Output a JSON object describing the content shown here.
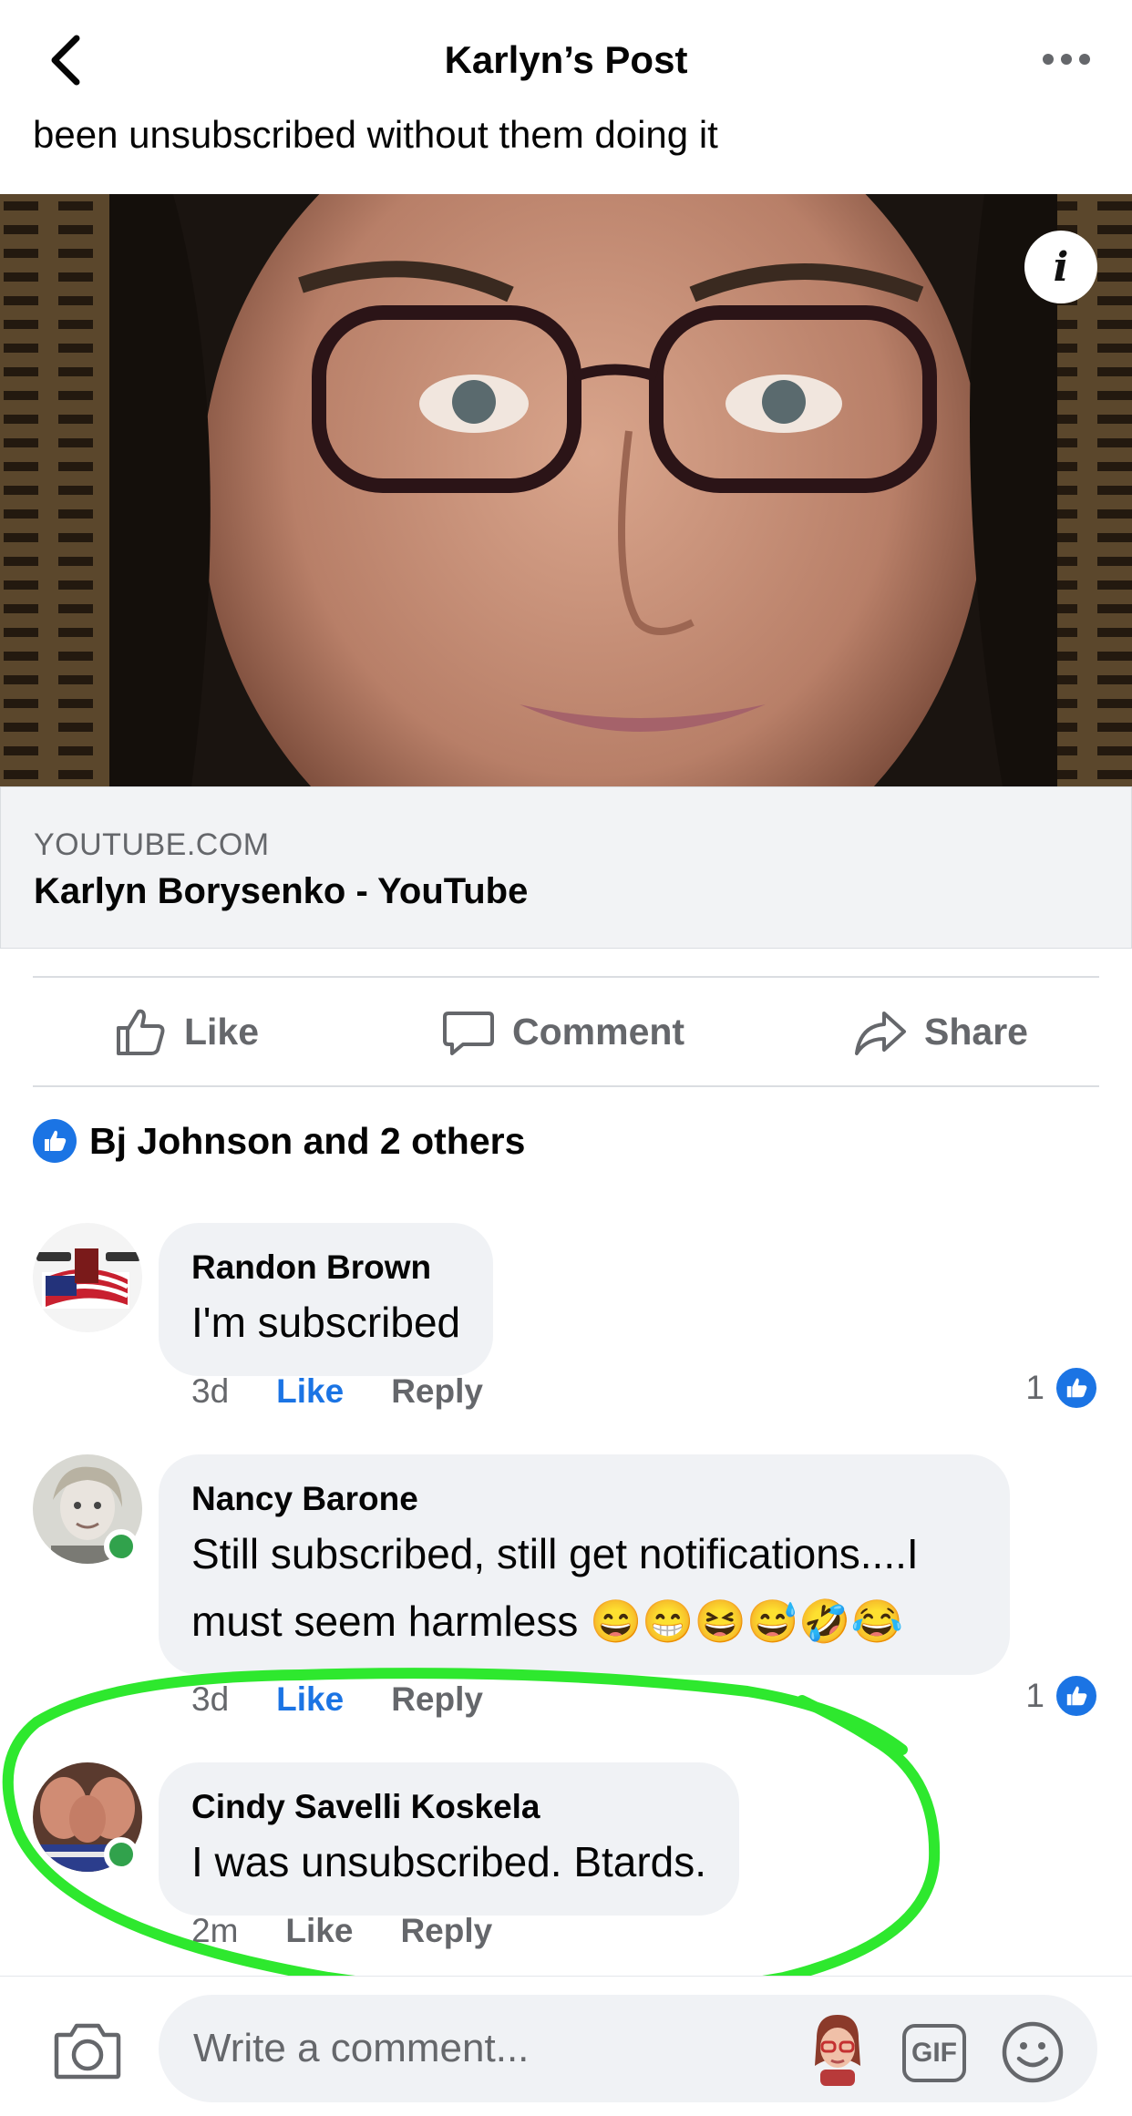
{
  "header": {
    "title": "Karlyn’s Post"
  },
  "post": {
    "text_snippet": "been unsubscribed without them doing it"
  },
  "link": {
    "domain": "YOUTUBE.COM",
    "title": "Karlyn Borysenko - YouTube"
  },
  "actions": {
    "like": "Like",
    "comment": "Comment",
    "share": "Share"
  },
  "reactions": {
    "summary": "Bj Johnson and 2 others"
  },
  "comments": [
    {
      "name": "Randon Brown",
      "text": "I'm subscribed",
      "time": "3d",
      "like": "Like",
      "reply": "Reply",
      "reactions": "1",
      "liked": true
    },
    {
      "name": "Nancy Barone",
      "text_line1": "Still subscribed, still get notifications....I",
      "text_line2": "must seem harmless",
      "emoji": "😄😁😆😅🤣😂",
      "time": "3d",
      "like": "Like",
      "reply": "Reply",
      "reactions": "1",
      "liked": true
    },
    {
      "name": "Cindy Savelli Koskela",
      "text": "I was unsubscribed. Btards.",
      "time": "2m",
      "like": "Like",
      "reply": "Reply"
    }
  ],
  "composer": {
    "placeholder": "Write a comment...",
    "gif_label": "GIF"
  },
  "colors": {
    "accent": "#1b74e4",
    "annotation": "#2ee82e",
    "online": "#31a24c"
  }
}
